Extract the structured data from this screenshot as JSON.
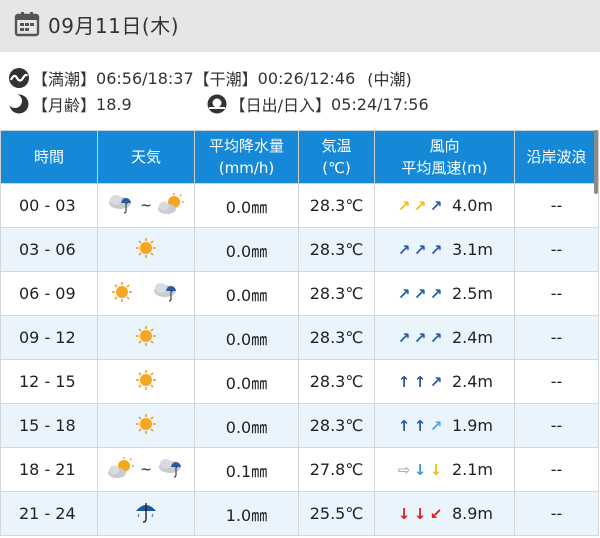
{
  "date_title": "09月11日(木)",
  "tide": {
    "high_label": "【満潮】",
    "high_value": "06:56/18:37",
    "low_label": "【干潮】",
    "low_value": "00:26/12:46",
    "tide_type": "(中潮)",
    "moon_label": "【月齢】",
    "moon_value": "18.9",
    "sun_label": "【日出/日入】",
    "sun_value": "05:24/17:56"
  },
  "table": {
    "headers": [
      "時間",
      "天気",
      "平均降水量",
      "(mm/h)",
      "気温",
      "(℃)",
      "風向",
      "平均風速(m)",
      "沿岸波浪"
    ],
    "rows": [
      {
        "time": "00 - 03",
        "weather": [
          "rain-cloud",
          "sun-cloud"
        ],
        "tilde": "~",
        "precip": "0.0㎜",
        "temp": "28.3℃",
        "arrows": [
          {
            "dir": "↗",
            "color": "#e8c020"
          },
          {
            "dir": "↗",
            "color": "#e8c020"
          },
          {
            "dir": "↗",
            "color": "#2a5a9e"
          }
        ],
        "wind": "4.0m",
        "wave": "--"
      },
      {
        "time": "03 - 06",
        "weather": [
          "sun"
        ],
        "tilde": "",
        "precip": "0.0㎜",
        "temp": "28.3℃",
        "arrows": [
          {
            "dir": "↗",
            "color": "#2a5a9e"
          },
          {
            "dir": "↗",
            "color": "#2a5a9e"
          },
          {
            "dir": "↗",
            "color": "#2a5a9e"
          }
        ],
        "wind": "3.1m",
        "wave": "--"
      },
      {
        "time": "06 - 09",
        "weather": [
          "sun",
          "rain-cloud"
        ],
        "tilde": "",
        "precip": "0.0㎜",
        "temp": "28.3℃",
        "arrows": [
          {
            "dir": "↗",
            "color": "#2a5a9e"
          },
          {
            "dir": "↗",
            "color": "#2a5a9e"
          },
          {
            "dir": "↗",
            "color": "#2a5a9e"
          }
        ],
        "wind": "2.5m",
        "wave": "--"
      },
      {
        "time": "09 - 12",
        "weather": [
          "sun"
        ],
        "tilde": "",
        "precip": "0.0㎜",
        "temp": "28.3℃",
        "arrows": [
          {
            "dir": "↗",
            "color": "#2a5a9e"
          },
          {
            "dir": "↗",
            "color": "#2a5a9e"
          },
          {
            "dir": "↗",
            "color": "#2a5a9e"
          }
        ],
        "wind": "2.4m",
        "wave": "--"
      },
      {
        "time": "12 - 15",
        "weather": [
          "sun"
        ],
        "tilde": "",
        "precip": "0.0㎜",
        "temp": "28.3℃",
        "arrows": [
          {
            "dir": "↑",
            "color": "#2a5a9e"
          },
          {
            "dir": "↑",
            "color": "#2a5a9e"
          },
          {
            "dir": "↗",
            "color": "#2a5a9e"
          }
        ],
        "wind": "2.4m",
        "wave": "--"
      },
      {
        "time": "15 - 18",
        "weather": [
          "sun"
        ],
        "tilde": "",
        "precip": "0.0㎜",
        "temp": "28.3℃",
        "arrows": [
          {
            "dir": "↑",
            "color": "#2a5a9e"
          },
          {
            "dir": "↑",
            "color": "#2a5a9e"
          },
          {
            "dir": "↗",
            "color": "#4aa8e0"
          }
        ],
        "wind": "1.9m",
        "wave": "--"
      },
      {
        "time": "18 - 21",
        "weather": [
          "sun-cloud",
          "rain-cloud"
        ],
        "tilde": "~",
        "precip": "0.1㎜",
        "temp": "27.8℃",
        "arrows": [
          {
            "dir": "⇨",
            "color": "#b0b0b0"
          },
          {
            "dir": "↓",
            "color": "#3a9ad8"
          },
          {
            "dir": "↓",
            "color": "#e8c020"
          }
        ],
        "wind": "2.1m",
        "wave": "--"
      },
      {
        "time": "21 - 24",
        "weather": [
          "umbrella"
        ],
        "tilde": "",
        "precip": "1.0㎜",
        "temp": "25.5℃",
        "arrows": [
          {
            "dir": "↓",
            "color": "#d02020"
          },
          {
            "dir": "↓",
            "color": "#d02020"
          },
          {
            "dir": "↙",
            "color": "#d02020"
          }
        ],
        "wind": "8.9m",
        "wave": "--"
      }
    ]
  }
}
